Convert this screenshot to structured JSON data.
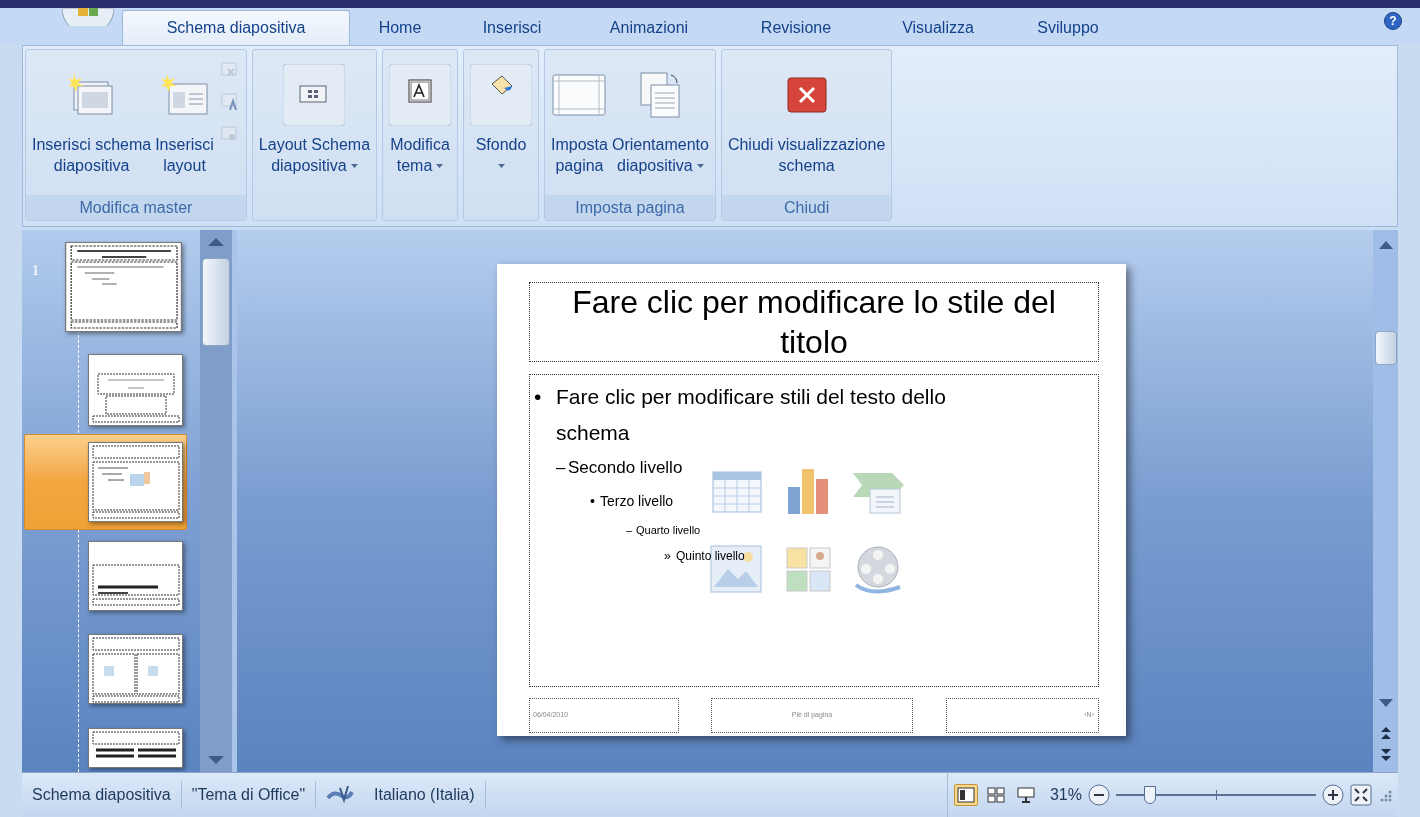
{
  "help": "?",
  "tabs": [
    {
      "label": "Schema diapositiva",
      "selected": true
    },
    {
      "label": "Home",
      "selected": false
    },
    {
      "label": "Inserisci",
      "selected": false
    },
    {
      "label": "Animazioni",
      "selected": false
    },
    {
      "label": "Revisione",
      "selected": false
    },
    {
      "label": "Visualizza",
      "selected": false
    },
    {
      "label": "Sviluppo",
      "selected": false
    }
  ],
  "ribbon_groups": [
    {
      "label": "Modifica master",
      "buttons": [
        {
          "kind": "large",
          "lines": [
            "Inserisci schema",
            "diapositiva"
          ],
          "dropdown": false
        },
        {
          "kind": "large",
          "lines": [
            "Inserisci",
            "layout"
          ],
          "dropdown": false
        },
        {
          "kind": "small-stack",
          "disabled": true
        }
      ]
    },
    {
      "buttons": [
        {
          "kind": "large",
          "lines": [
            "Layout Schema",
            "diapositiva"
          ],
          "dropdown": true
        }
      ]
    },
    {
      "buttons": [
        {
          "kind": "large",
          "lines": [
            "Modifica",
            "tema"
          ],
          "dropdown": true
        }
      ]
    },
    {
      "buttons": [
        {
          "kind": "large",
          "lines": [
            "Sfondo"
          ],
          "dropdown": true
        }
      ]
    },
    {
      "label": "Imposta pagina",
      "buttons": [
        {
          "kind": "large",
          "lines": [
            "Imposta",
            "pagina"
          ],
          "dropdown": false
        },
        {
          "kind": "large",
          "lines": [
            "Orientamento",
            "diapositiva"
          ],
          "dropdown": true
        }
      ]
    },
    {
      "label": "Chiudi",
      "buttons": [
        {
          "kind": "large",
          "lines": [
            "Chiudi visualizzazione",
            "schema"
          ],
          "dropdown": false
        }
      ]
    }
  ],
  "thumbnails": [
    {
      "number": "1",
      "selected": false
    },
    {
      "selected": false
    },
    {
      "selected": true
    },
    {
      "selected": false
    },
    {
      "selected": false
    },
    {
      "selected": false
    }
  ],
  "slide": {
    "title": "Fare clic per modificare lo stile del titolo",
    "bullets": [
      {
        "marker": "•",
        "text": "Fare clic per modificare stili del testo dello schema",
        "children": [
          {
            "marker": "–",
            "text": "Secondo livello",
            "children": [
              {
                "marker": "•",
                "text": "Terzo livello",
                "children": [
                  {
                    "marker": "–",
                    "text": "Quarto livello",
                    "children": [
                      {
                        "marker": "»",
                        "text": "Quinto livello"
                      }
                    ]
                  }
                ]
              }
            ]
          }
        ]
      }
    ],
    "footer": {
      "date": "06/04/2010",
      "center": "Piè di pagina",
      "number": "‹N›"
    }
  },
  "status_bar": {
    "items": [
      "Schema diapositiva",
      "\"Tema di Office\""
    ],
    "language": "Italiano (Italia)",
    "views": [
      {
        "selected": true
      },
      {
        "selected": false
      },
      {
        "selected": false
      }
    ],
    "zoom": "31%",
    "zoom_slider": {
      "level": 0.17
    }
  }
}
